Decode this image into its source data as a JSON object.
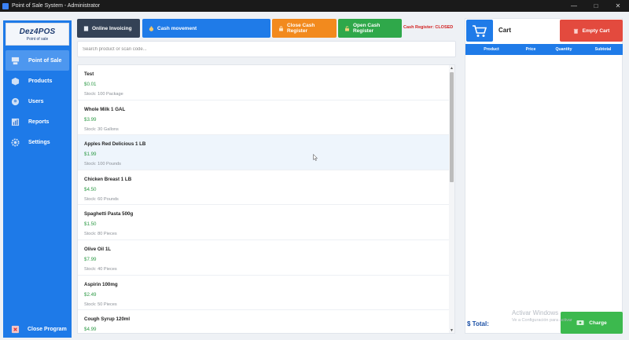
{
  "window": {
    "title": "Point of Sale System - Administrator"
  },
  "sidebar": {
    "logo_title": "Dez4POS",
    "logo_subtitle": "Point of sale",
    "items": [
      {
        "label": "Point of Sale",
        "icon": "pos-icon",
        "active": true
      },
      {
        "label": "Products",
        "icon": "box-icon",
        "active": false
      },
      {
        "label": "Users",
        "icon": "users-icon",
        "active": false
      },
      {
        "label": "Reports",
        "icon": "chart-icon",
        "active": false
      },
      {
        "label": "Settings",
        "icon": "gear-icon",
        "active": false
      }
    ],
    "close_label": "Close Program"
  },
  "toolbar": {
    "online_invoicing": "Online Invoicing",
    "cash_movement": "Cash movement",
    "close_register": "Close Cash Register",
    "open_register": "Open Cash Register",
    "register_status": "Cash Register: CLOSED"
  },
  "search": {
    "placeholder": "Search product or scan code..."
  },
  "products": [
    {
      "name": "Test",
      "price": "$0.01",
      "stock": "Stock: 100 Package"
    },
    {
      "name": "Whole Milk 1 GAL",
      "price": "$3.99",
      "stock": "Stock: 30 Gallons"
    },
    {
      "name": "Apples Red Delicious 1 LB",
      "price": "$1.99",
      "stock": "Stock: 100 Pounds"
    },
    {
      "name": "Chicken Breast 1 LB",
      "price": "$4.50",
      "stock": "Stock: 60 Pounds"
    },
    {
      "name": "Spaghetti Pasta 500g",
      "price": "$1.50",
      "stock": "Stock: 80 Pieces"
    },
    {
      "name": "Olive Oil 1L",
      "price": "$7.99",
      "stock": "Stock: 40 Pieces"
    },
    {
      "name": "Aspirin 100mg",
      "price": "$2.49",
      "stock": "Stock: 50 Pieces"
    },
    {
      "name": "Cough Syrup 120ml",
      "price": "$4.99",
      "stock": ""
    }
  ],
  "cart": {
    "title": "Cart",
    "empty_label": "Empty Cart",
    "columns": [
      "Product",
      "Price",
      "Quantity",
      "Subtotal"
    ],
    "total_label": "$ Total:",
    "charge_label": "Charge"
  },
  "watermark": {
    "line1": "Activar Windows",
    "line2": "Ve a Configuración para activar"
  },
  "colors": {
    "sidebar": "#1e7ae8",
    "online": "#344256",
    "cash": "#1f7be8",
    "close_register": "#f28a1e",
    "open_register": "#2fa84a",
    "empty_cart": "#e34a3e",
    "charge": "#3cb94e",
    "price": "#2e9a46",
    "status_closed": "#d11f1f"
  }
}
